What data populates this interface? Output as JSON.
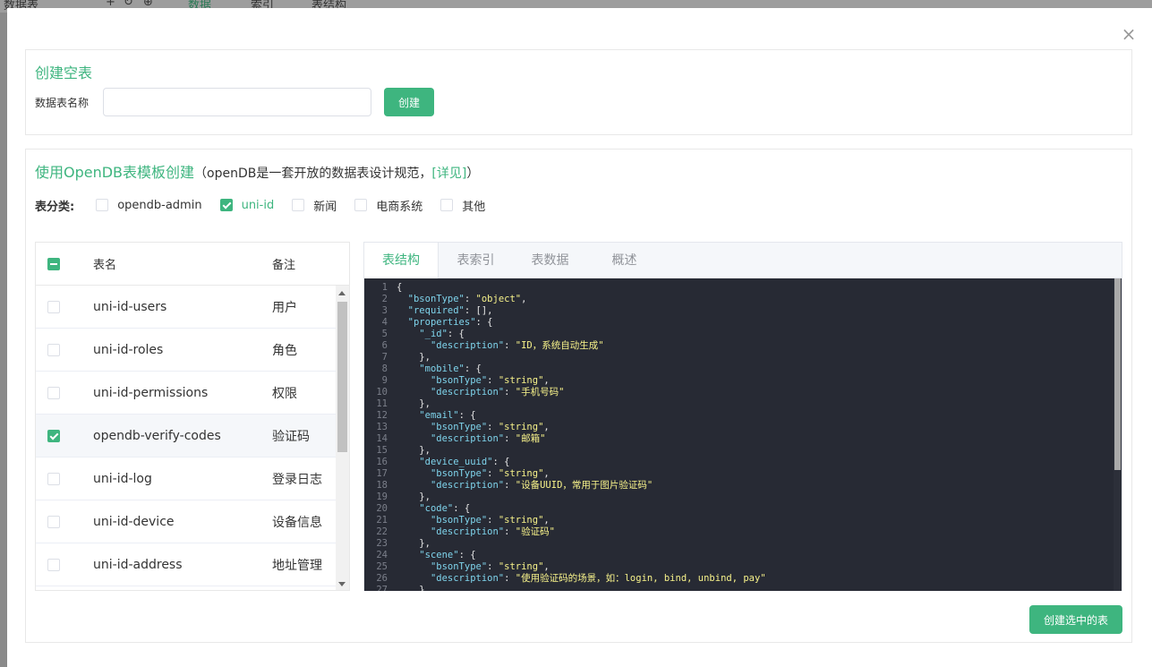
{
  "background": {
    "items": [
      "数据表",
      "+",
      "↻",
      "⊕",
      "数据",
      "索引",
      "表结构"
    ]
  },
  "modal": {
    "close_icon": "close-icon"
  },
  "create_empty": {
    "title": "创建空表",
    "field_label": "数据表名称",
    "input_value": "",
    "input_placeholder": "",
    "create_button": "创建"
  },
  "template": {
    "title": "使用OpenDB表模板创建",
    "subtitle_prefix": "（openDB是一套开放的数据表设计规范，",
    "link": "[详见]",
    "subtitle_suffix": "）",
    "category_label": "表分类:",
    "categories": [
      {
        "label": "opendb-admin",
        "checked": false
      },
      {
        "label": "uni-id",
        "checked": true
      },
      {
        "label": "新闻",
        "checked": false
      },
      {
        "label": "电商系统",
        "checked": false
      },
      {
        "label": "其他",
        "checked": false
      }
    ],
    "list_header": {
      "name": "表名",
      "note": "备注"
    },
    "rows": [
      {
        "name": "uni-id-users",
        "note": "用户",
        "checked": false
      },
      {
        "name": "uni-id-roles",
        "note": "角色",
        "checked": false
      },
      {
        "name": "uni-id-permissions",
        "note": "权限",
        "checked": false
      },
      {
        "name": "opendb-verify-codes",
        "note": "验证码",
        "checked": true
      },
      {
        "name": "uni-id-log",
        "note": "登录日志",
        "checked": false
      },
      {
        "name": "uni-id-device",
        "note": "设备信息",
        "checked": false
      },
      {
        "name": "uni-id-address",
        "note": "地址管理",
        "checked": false
      }
    ],
    "tabs": [
      "表结构",
      "表索引",
      "表数据",
      "概述"
    ],
    "active_tab": 0,
    "code_lines": [
      "{",
      "  \"bsonType\": \"object\",",
      "  \"required\": [],",
      "  \"properties\": {",
      "    \"_id\": {",
      "      \"description\": \"ID，系统自动生成\"",
      "    },",
      "    \"mobile\": {",
      "      \"bsonType\": \"string\",",
      "      \"description\": \"手机号码\"",
      "    },",
      "    \"email\": {",
      "      \"bsonType\": \"string\",",
      "      \"description\": \"邮箱\"",
      "    },",
      "    \"device_uuid\": {",
      "      \"bsonType\": \"string\",",
      "      \"description\": \"设备UUID，常用于图片验证码\"",
      "    },",
      "    \"code\": {",
      "      \"bsonType\": \"string\",",
      "      \"description\": \"验证码\"",
      "    },",
      "    \"scene\": {",
      "      \"bsonType\": \"string\",",
      "      \"description\": \"使用验证码的场景，如：login, bind, unbind, pay\"",
      "    }"
    ],
    "create_selected_button": "创建选中的表"
  },
  "colors": {
    "accent": "#3eb57f",
    "code_bg": "#272a34",
    "code_key": "#7fd4ec",
    "code_string": "#f7f28a"
  }
}
